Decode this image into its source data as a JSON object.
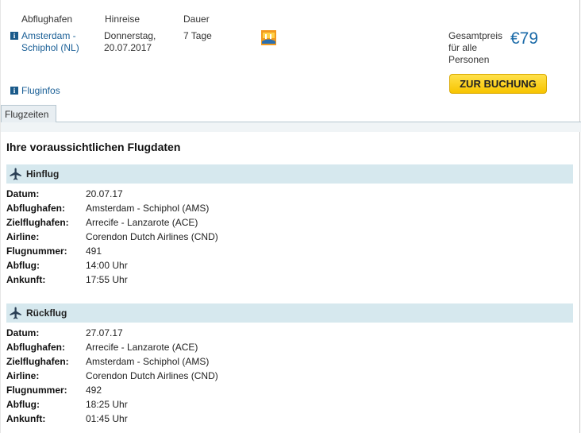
{
  "header": {
    "col_departure": "Abflughafen",
    "col_outbound": "Hinreise",
    "col_duration": "Dauer"
  },
  "summary": {
    "airport_line1": "Amsterdam -",
    "airport_line2": "Schiphol (NL)",
    "date_line1": "Donnerstag,",
    "date_line2": "20.07.2017",
    "duration": "7 Tage",
    "flight_info_link": "Fluginfos",
    "price_label_line1": "Gesamtpreis",
    "price_label_line2": "für alle",
    "price_label_line3": "Personen",
    "price": "€79",
    "book_button": "ZUR BUCHUNG"
  },
  "tabs": [
    {
      "label": "Flugzeiten"
    }
  ],
  "section_title": "Ihre voraussichtlichen Flugdaten",
  "outbound": {
    "title": "Hinflug",
    "rows": [
      {
        "label": "Datum:",
        "value": "20.07.17"
      },
      {
        "label": "Abflughafen:",
        "value": "Amsterdam - Schiphol (AMS)"
      },
      {
        "label": "Zielflughafen:",
        "value": "Arrecife - Lanzarote (ACE)"
      },
      {
        "label": "Airline:",
        "value": "Corendon Dutch Airlines (CND)"
      },
      {
        "label": "Flugnummer:",
        "value": "491"
      },
      {
        "label": "Abflug:",
        "value": "14:00 Uhr"
      },
      {
        "label": "Ankunft:",
        "value": "17:55 Uhr"
      }
    ]
  },
  "return": {
    "title": "Rückflug",
    "rows": [
      {
        "label": "Datum:",
        "value": "27.07.17"
      },
      {
        "label": "Abflughafen:",
        "value": "Arrecife - Lanzarote (ACE)"
      },
      {
        "label": "Zielflughafen:",
        "value": "Amsterdam - Schiphol (AMS)"
      },
      {
        "label": "Airline:",
        "value": "Corendon Dutch Airlines (CND)"
      },
      {
        "label": "Flugnummer:",
        "value": "492"
      },
      {
        "label": "Abflug:",
        "value": "18:25 Uhr"
      },
      {
        "label": "Ankunft:",
        "value": "01:45 Uhr"
      }
    ]
  },
  "colors": {
    "link": "#1a5f96",
    "price": "#1a6aa8",
    "button": "#f7c400",
    "section_bar": "#d6e8ee"
  }
}
